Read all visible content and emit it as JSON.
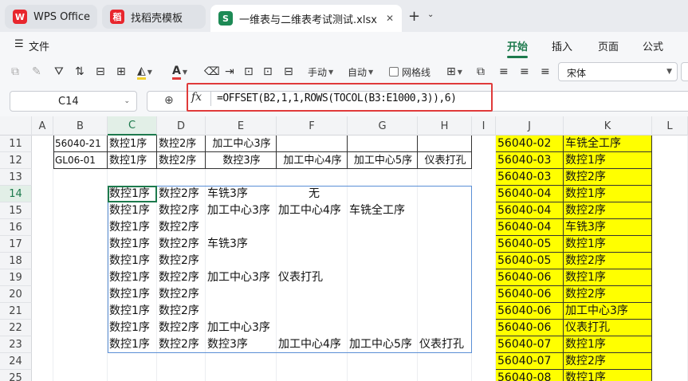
{
  "tabs": {
    "wps": {
      "label": "WPS Office",
      "logo": "W"
    },
    "template": {
      "label": "找稻壳模板",
      "logo": "稻"
    },
    "doc": {
      "label": "一维表与二维表考试测试.xlsx",
      "logo": "S",
      "close": "✕"
    },
    "new_tab": "+",
    "new_tab_caret": "⌄"
  },
  "menu": {
    "hamburger": "☰",
    "file": "文件",
    "ribbon_tabs": [
      "开始",
      "插入",
      "页面",
      "公式"
    ],
    "active_tab": "开始"
  },
  "toolbar": {
    "fill_handle": "手动",
    "auto": "自动",
    "gridlines": "网格线",
    "font_name": "宋体"
  },
  "formula_bar": {
    "name_box": "C14",
    "fx": "fx",
    "formula": "=OFFSET(B2,1,1,ROWS(TOCOL(B3:E1000,3)),6)"
  },
  "grid": {
    "columns": [
      "A",
      "B",
      "C",
      "D",
      "E",
      "F",
      "G",
      "H",
      "I",
      "J",
      "K",
      "L"
    ],
    "selected_column": "C",
    "rows": [
      "11",
      "12",
      "13",
      "14",
      "15",
      "16",
      "17",
      "18",
      "19",
      "20",
      "21",
      "22",
      "23",
      "24",
      "25"
    ],
    "selected_row": "14",
    "table_rows": [
      [
        "56040-21",
        "数控1序",
        "数控2序",
        "加工中心3序",
        "",
        "",
        ""
      ],
      [
        "GL06-01",
        "数控1序",
        "数控2序",
        "数控3序",
        "加工中心4序",
        "加工中心5序",
        "仪表打孔"
      ]
    ],
    "spill_rows": [
      [
        "数控1序",
        "数控2序",
        "车铣3序",
        "无",
        "",
        ""
      ],
      [
        "数控1序",
        "数控2序",
        "加工中心3序",
        "加工中心4序",
        "车铣全工序",
        ""
      ],
      [
        "数控1序",
        "数控2序",
        "",
        "",
        "",
        ""
      ],
      [
        "数控1序",
        "数控2序",
        "车铣3序",
        "",
        "",
        ""
      ],
      [
        "数控1序",
        "数控2序",
        "",
        "",
        "",
        ""
      ],
      [
        "数控1序",
        "数控2序",
        "加工中心3序",
        "仪表打孔",
        "",
        ""
      ],
      [
        "数控1序",
        "数控2序",
        "",
        "",
        "",
        ""
      ],
      [
        "数控1序",
        "数控2序",
        "",
        "",
        "",
        ""
      ],
      [
        "数控1序",
        "数控2序",
        "加工中心3序",
        "",
        "",
        ""
      ],
      [
        "数控1序",
        "数控2序",
        "数控3序",
        "加工中心4序",
        "加工中心5序",
        "仪表打孔"
      ]
    ],
    "jk_rows": [
      [
        "56040-02",
        "车铣全工序"
      ],
      [
        "56040-03",
        "数控1序"
      ],
      [
        "56040-03",
        "数控2序"
      ],
      [
        "56040-04",
        "数控1序"
      ],
      [
        "56040-04",
        "数控2序"
      ],
      [
        "56040-04",
        "车铣3序"
      ],
      [
        "56040-05",
        "数控1序"
      ],
      [
        "56040-05",
        "数控2序"
      ],
      [
        "56040-06",
        "数控1序"
      ],
      [
        "56040-06",
        "数控2序"
      ],
      [
        "56040-06",
        "加工中心3序"
      ],
      [
        "56040-06",
        "仪表打孔"
      ],
      [
        "56040-07",
        "数控1序"
      ],
      [
        "56040-07",
        "数控2序"
      ],
      [
        "56040-08",
        "数控1序"
      ]
    ],
    "highlight_color": "#ffff00"
  }
}
